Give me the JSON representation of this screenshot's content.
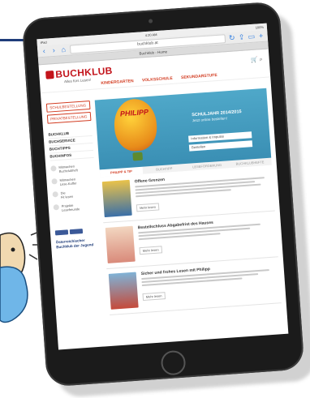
{
  "browser": {
    "status_left": "iPad",
    "status_time": "4:20 AM",
    "status_right": "100%",
    "url": "buchklub.at",
    "tab_title": "Buchklub - Home",
    "reload_icon": "reload-icon",
    "share_icon": "share-icon",
    "bookmarks_icon": "book-icon",
    "add_tab_icon": "plus-icon"
  },
  "header": {
    "logo_text": "BUCHKLUB",
    "tagline": "Alles fürs Lesen!",
    "cart_icon": "cart-icon",
    "search_icon": "search-icon"
  },
  "nav": {
    "items": [
      "KINDERGARTEN",
      "VOLKSSCHULE",
      "SEKUNDARSTUFE"
    ]
  },
  "sidebar": {
    "buttons": [
      "SCHULBESTELLUNG",
      "PRIVATBESTELLUNG"
    ],
    "menu": [
      "BUCHKLUB",
      "BUCHSERVICE",
      "BUCHTIPPS",
      "BUCHINFOS"
    ],
    "features": [
      {
        "title": "Mitmachen",
        "text": "Buchclubheft"
      },
      {
        "title": "Mitmachen",
        "text": "Lese-Koffer"
      },
      {
        "title": "Die",
        "text": "Fit lesen"
      },
      {
        "title": "Projekte",
        "text": "Lesefreunde"
      }
    ],
    "promo": "Österreichischer Buchklub der Jugend"
  },
  "banner": {
    "balloon_text": "PHILIPP",
    "title": "SCHULJAHR 2014/2015",
    "subtitle": "Jetzt online bestellen!",
    "select_1": "Information & Impulse",
    "select_2": "Bestellen",
    "tabs": [
      "PHILIPP & TIP",
      "BUCHTIPP",
      "LESEFÖRDERUNG",
      "BUCHKLUBHEFTE"
    ]
  },
  "articles": [
    {
      "title": "Offene Grenzen",
      "more": "Mehr lesen"
    },
    {
      "title": "Bestellschluss Abgabefrist des Hauses",
      "more": "Mehr lesen"
    },
    {
      "title": "Sicher und frohes Lesen mit Philipp",
      "more": "Mehr lesen"
    }
  ],
  "colors": {
    "brand_red": "#c3141b",
    "nav_orange": "#d23b20",
    "banner_blue": "#4fa8c9",
    "accent_navy": "#1f3d7a"
  }
}
